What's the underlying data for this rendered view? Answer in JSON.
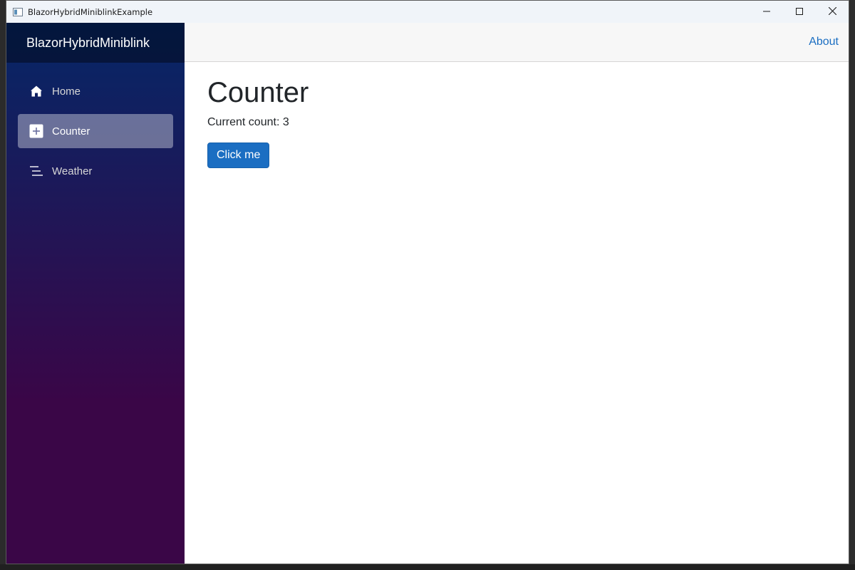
{
  "window": {
    "title": "BlazorHybridMiniblinkExample"
  },
  "caption_buttons": {
    "minimize_icon": "minimize-icon",
    "maximize_icon": "maximize-icon",
    "close_icon": "close-icon"
  },
  "sidebar": {
    "brand": "BlazorHybridMiniblink",
    "items": [
      {
        "label": "Home",
        "icon": "home-icon",
        "active": false
      },
      {
        "label": "Counter",
        "icon": "plus-icon",
        "active": true
      },
      {
        "label": "Weather",
        "icon": "list-icon",
        "active": false
      }
    ]
  },
  "topbar": {
    "about_label": "About"
  },
  "main": {
    "title": "Counter",
    "count_text": "Current count: 3",
    "button_label": "Click me"
  },
  "colors": {
    "accent": "#1b6ec2",
    "sidebar_top": "#052767",
    "sidebar_bottom": "#3a0647"
  }
}
